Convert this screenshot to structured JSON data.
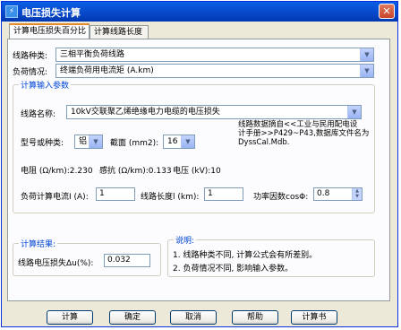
{
  "window": {
    "title": "电压损失计算"
  },
  "tabs": [
    {
      "label": "计算电压损失百分比"
    },
    {
      "label": "计算线路长度"
    }
  ],
  "route_type": {
    "label": "线路种类:",
    "value": "三相平衡负荷线路"
  },
  "load_case": {
    "label": "负荷情况:",
    "value": "终端负荷用电流矩 (A.km)"
  },
  "params": {
    "title": "计算输入参数",
    "line_name_label": "线路名称:",
    "line_name_value": "10kV交联聚乙烯绝缘电力电缆的电压损失",
    "model_label": "型号或种类:",
    "model_value": "铝",
    "section_label": "截面 (mm2):",
    "section_value": "16",
    "source_note": "线路数据摘自<<工业与民用配电设\n计手册>>P429~P43,数据库文件名为\nDyssCal.Mdb.",
    "resistance": "电阻 (Ω/km):2.230",
    "reactance": "感抗 (Ω/km):0.133",
    "voltage": "电压 (kV):10",
    "current_label": "负荷计算电流I (A):",
    "current_value": "1",
    "length_label": "线路长度l (km):",
    "length_value": "1",
    "pf_label": "功率因数cosΦ:",
    "pf_value": "0.8"
  },
  "result": {
    "title": "计算结果:",
    "label": "线路电压损失Δu(%):",
    "value": "0.032"
  },
  "notes": {
    "title": "说明:",
    "lines": [
      "1. 线路种类不同, 计算公式会有所差别。",
      "2. 负荷情况不同, 影响输入参数。"
    ]
  },
  "buttons": {
    "calc": "计算",
    "ok": "确定",
    "cancel": "取消",
    "help": "帮助",
    "report": "计算书"
  }
}
